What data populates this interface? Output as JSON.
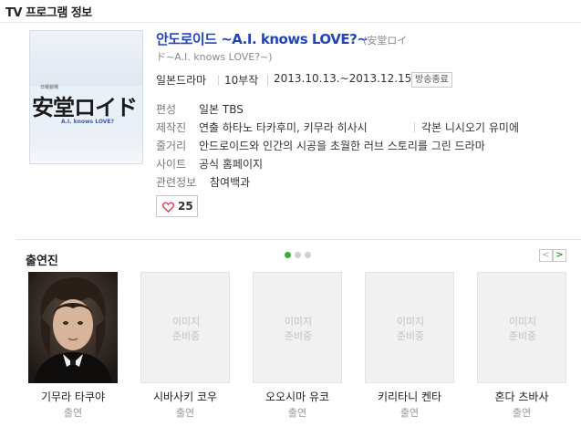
{
  "section_title": "TV 프로그램 정보",
  "poster": {
    "logo_text": "安堂ロイド",
    "subtitle": "A.I. knows LOVE?",
    "mini_caption": "日曜劇場"
  },
  "drama": {
    "title": "안도로이드 ~A.I. knows LOVE?~",
    "original_title_line1": "(安堂ロイ",
    "original_title_line2": "ド~A.I. knows LOVE?~)",
    "genre": "일본드라마",
    "episodes": "10부작",
    "air_dates": "2013.10.13.~2013.12.15.",
    "status": "방송종료"
  },
  "info": {
    "broadcaster_label": "편성",
    "broadcaster": "일본 TBS",
    "staff_label": "제작진",
    "director": "연출 하타노 타카후미, 키무라 히사시",
    "writer": "각본 니시오기 유미에",
    "synopsis_label": "줄거리",
    "synopsis": "안드로이드와 인간의 시공을 초월한 러브 스토리를 그린 드라마",
    "site_label": "사이트",
    "site": "공식 홈페이지",
    "related_label": "관련정보",
    "related": "참여백과"
  },
  "like": {
    "count": "25"
  },
  "cast_section": {
    "title": "출연진",
    "prev": "<",
    "next": ">",
    "page_dots": 3,
    "active_dot": 1,
    "placeholder_line1": "이미지",
    "placeholder_line2": "준비중",
    "members": [
      {
        "name": "기무라 타쿠야",
        "role": "출연",
        "has_photo": true
      },
      {
        "name": "시바사키 코우",
        "role": "출연",
        "has_photo": false
      },
      {
        "name": "오오시마 유코",
        "role": "출연",
        "has_photo": false
      },
      {
        "name": "키리타니 켄타",
        "role": "출연",
        "has_photo": false
      },
      {
        "name": "혼다 츠바사",
        "role": "출연",
        "has_photo": false
      }
    ]
  },
  "colors": {
    "title_link": "#2346b6",
    "dot_active": "#3cab3c",
    "dot_inactive": "#d0d0d0",
    "next_arrow": "#2e9a2e",
    "heart": "#e1394b"
  }
}
